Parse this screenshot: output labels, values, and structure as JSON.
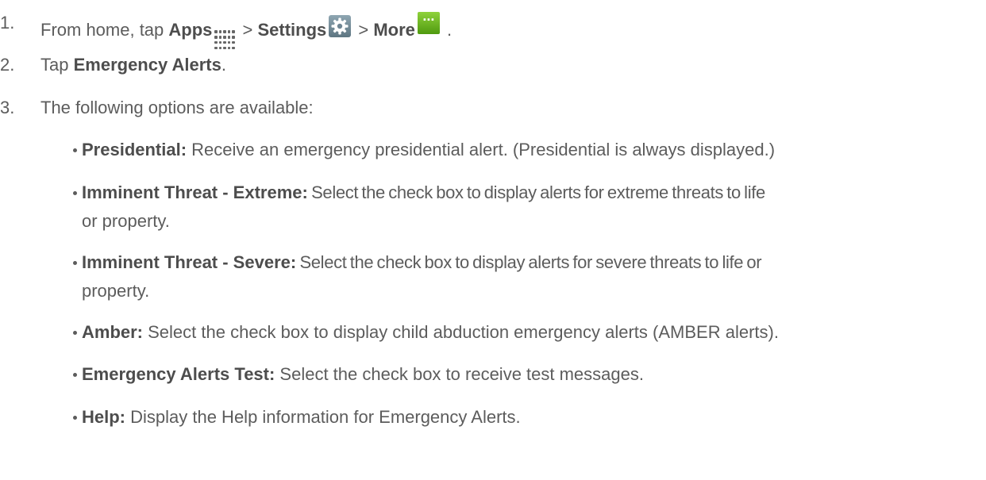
{
  "steps": [
    {
      "number": "1.",
      "prefix": "From home, tap ",
      "apps": "Apps",
      "sep1": " > ",
      "settings": "Settings",
      "sep2": " > ",
      "more": "More",
      "suffix": " ."
    },
    {
      "number": "2.",
      "prefix": "Tap ",
      "bold": "Emergency Alerts",
      "suffix": "."
    },
    {
      "number": "3.",
      "text": "The following options are available:"
    }
  ],
  "icons": {
    "apps": "apps-grid-icon",
    "settings": "settings-gear-icon",
    "more": "more-dots-icon"
  },
  "options": [
    {
      "term": "Presidential:",
      "desc": " Receive an emergency presidential alert. (Presidential is always displayed.)"
    },
    {
      "term": "Imminent Threat - Extreme:",
      "desc_line1": " Select the check box to display alerts for extreme threats to life",
      "desc_line2": "or property."
    },
    {
      "term": "Imminent Threat - Severe:",
      "desc_line1": " Select the check box to display alerts for severe threats to life or",
      "desc_line2": "property."
    },
    {
      "term": "Amber:",
      "desc": " Select the check box to display child abduction emergency alerts (AMBER alerts)."
    },
    {
      "term": "Emergency Alerts Test:",
      "desc": " Select the check box to receive test messages."
    },
    {
      "term": "Help:",
      "desc": " Display the Help information for Emergency Alerts."
    }
  ],
  "colors": {
    "text": "#5c5c5c",
    "more_icon_green": "#6cb825",
    "settings_icon_gray": "#7a909b"
  }
}
